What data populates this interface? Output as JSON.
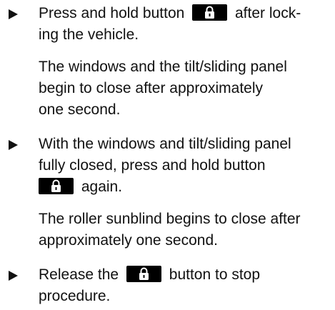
{
  "steps": [
    {
      "instruction_before": "Press and hold button",
      "icon": "lock-icon",
      "instruction_after_line1": "after lock-",
      "instruction_line2": "ing the vehicle.",
      "result_line1": "The windows and the tilt/sliding panel",
      "result_line2": "begin to close after approximately",
      "result_line3": "one second."
    },
    {
      "instruction_line1": "With the windows and tilt/sliding panel",
      "instruction_line2": "fully closed, press and hold button",
      "icon": "lock-icon",
      "instruction_after": "again.",
      "result_line1": "The roller sunblind begins to close after",
      "result_line2": "approximately one second."
    },
    {
      "instruction_before": "Release the",
      "icon": "lock-icon",
      "instruction_after": "button to stop",
      "instruction_line2": "procedure."
    }
  ]
}
